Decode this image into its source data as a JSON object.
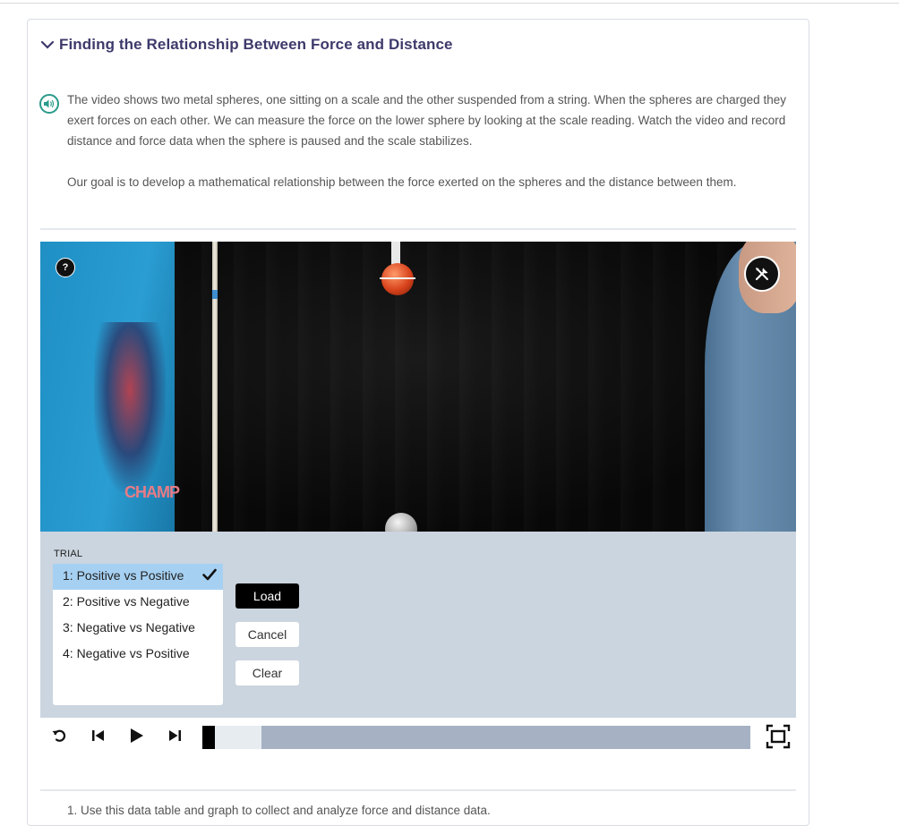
{
  "section": {
    "title": "Finding the Relationship Between Force and Distance",
    "paragraphs": [
      "The video shows two metal spheres, one sitting on a scale and the other suspended from a string. When the spheres are charged they exert forces on each other. We can measure the force on the lower sphere by looking at the scale reading. Watch the video and record distance and force data when the sphere is paused and the scale stabilizes.",
      "Our goal is to develop a mathematical relationship between the force exerted on the spheres and the distance between them."
    ]
  },
  "video": {
    "help_label": "?",
    "shirt_text": "CHAMP",
    "icons": {
      "help": "question-icon",
      "tools": "tools-icon",
      "audio": "speaker-icon"
    }
  },
  "trial": {
    "label": "TRIAL",
    "items": [
      {
        "label": "1: Positive vs Positive",
        "selected": true
      },
      {
        "label": "2: Positive vs Negative",
        "selected": false
      },
      {
        "label": "3: Negative vs Negative",
        "selected": false
      },
      {
        "label": "4: Negative vs Positive",
        "selected": false
      }
    ],
    "buttons": {
      "load": "Load",
      "cancel": "Cancel",
      "clear": "Clear"
    }
  },
  "player": {
    "progress_fraction": 0.0,
    "buffered_fraction": 0.108,
    "icons": [
      "replay-icon",
      "step-back-icon",
      "play-icon",
      "step-forward-icon",
      "fullscreen-icon"
    ]
  },
  "colors": {
    "title": "#3d3a6b",
    "accent_teal": "#2b9a8a",
    "panel_bg": "#cbd5df",
    "selected_bg": "#a6d0f2",
    "timeline_bg": "#a6b2c3"
  },
  "next_item_snippet": "1. Use this data table and graph to collect and analyze force and distance data."
}
